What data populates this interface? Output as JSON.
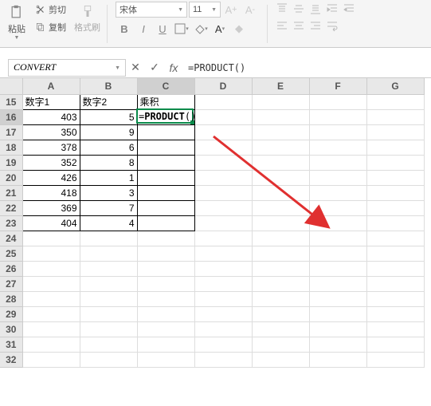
{
  "toolbar": {
    "paste_label": "粘贴",
    "cut_label": "剪切",
    "copy_label": "复制",
    "format_brush_label": "格式刷",
    "font_name": "宋体",
    "font_size": "11",
    "bold": "B",
    "italic": "I",
    "underline": "U"
  },
  "formula_bar": {
    "name_box": "CONVERT",
    "fx_label": "fx",
    "formula": "=PRODUCT()"
  },
  "columns": [
    "A",
    "B",
    "C",
    "D",
    "E",
    "F",
    "G"
  ],
  "rows_visible": [
    15,
    16,
    17,
    18,
    19,
    20,
    21,
    22,
    23,
    24,
    25,
    26,
    27,
    28,
    29,
    30,
    31,
    32
  ],
  "active_cell": {
    "col": "C",
    "row": 16
  },
  "active_formula_display": "=PRODUCT()",
  "headers": {
    "A": "数字1",
    "B": "数字2",
    "C": "乘积"
  },
  "data_rows": [
    {
      "row": 16,
      "A": 403,
      "B": 5
    },
    {
      "row": 17,
      "A": 350,
      "B": 9
    },
    {
      "row": 18,
      "A": 378,
      "B": 6
    },
    {
      "row": 19,
      "A": 352,
      "B": 8
    },
    {
      "row": 20,
      "A": 426,
      "B": 1
    },
    {
      "row": 21,
      "A": 418,
      "B": 3
    },
    {
      "row": 22,
      "A": 369,
      "B": 7
    },
    {
      "row": 23,
      "A": 404,
      "B": 4
    }
  ]
}
